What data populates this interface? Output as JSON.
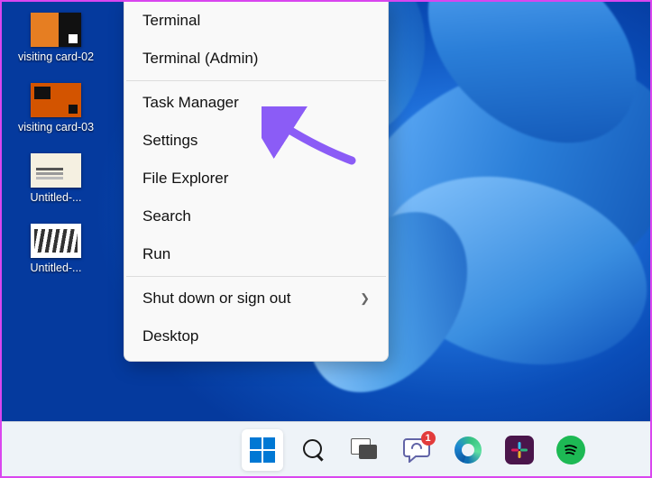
{
  "desktop": {
    "icons": [
      {
        "label": "visiting card-02",
        "thumbClass": "t-orange"
      },
      {
        "label": "visiting card-03",
        "thumbClass": "t-orange2"
      },
      {
        "label": "Untitled-...",
        "thumbClass": "t-card"
      },
      {
        "label": "Untitled-...",
        "thumbClass": "t-people"
      }
    ]
  },
  "context_menu": {
    "groups": [
      [
        {
          "label": "Terminal",
          "submenu": false
        },
        {
          "label": "Terminal (Admin)",
          "submenu": false
        }
      ],
      [
        {
          "label": "Task Manager",
          "submenu": false
        },
        {
          "label": "Settings",
          "submenu": false
        },
        {
          "label": "File Explorer",
          "submenu": false
        },
        {
          "label": "Search",
          "submenu": false
        },
        {
          "label": "Run",
          "submenu": false
        }
      ],
      [
        {
          "label": "Shut down or sign out",
          "submenu": true
        },
        {
          "label": "Desktop",
          "submenu": false
        }
      ]
    ]
  },
  "taskbar": {
    "items": [
      {
        "name": "start",
        "active": true
      },
      {
        "name": "search"
      },
      {
        "name": "task-view"
      },
      {
        "name": "chat",
        "badge": "1"
      },
      {
        "name": "edge"
      },
      {
        "name": "slack"
      },
      {
        "name": "spotify"
      }
    ]
  },
  "annotation": {
    "arrow_color": "#8b5cf6"
  }
}
